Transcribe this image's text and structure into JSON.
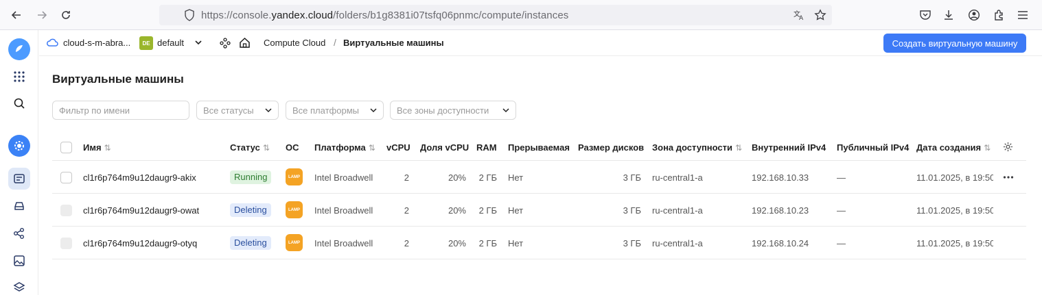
{
  "browser": {
    "url_prefix": "https://console.",
    "url_domain": "yandex.cloud",
    "url_path": "/folders/b1g8381i07tsfq06pnmc/compute/instances"
  },
  "header": {
    "cloud": "cloud-s-m-abra...",
    "folder_badge": "DE",
    "folder": "default",
    "breadcrumb_service": "Compute Cloud",
    "breadcrumb_sep": "/",
    "breadcrumb_page": "Виртуальные машины",
    "create_button": "Создать виртуальную машину"
  },
  "page": {
    "title": "Виртуальные машины"
  },
  "filters": {
    "name_placeholder": "Фильтр по имени",
    "status": "Все статусы",
    "platform": "Все платформы",
    "zone": "Все зоны доступности"
  },
  "table": {
    "columns": {
      "name": "Имя",
      "status": "Статус",
      "os": "ОС",
      "platform": "Платформа",
      "vcpu": "vCPU",
      "vcpu_share": "Доля vCPU",
      "ram": "RAM",
      "preemptible": "Прерываемая",
      "disk": "Размер дисков",
      "zone": "Зона доступности",
      "ipv4_int": "Внутренний IPv4",
      "ipv4_pub": "Публичный IPv4",
      "created": "Дата создания"
    },
    "os_label": "LAMP",
    "rows": [
      {
        "name": "cl1r6p764m9u12daugr9-akix",
        "status": "Running",
        "platform": "Intel Broadwell",
        "vcpu": "2",
        "vcpu_share": "20%",
        "ram": "2 ГБ",
        "preemptible": "Нет",
        "disk": "3 ГБ",
        "zone": "ru-central1-a",
        "ipv4_int": "192.168.10.33",
        "ipv4_pub": "—",
        "created": "11.01.2025, в 19:50"
      },
      {
        "name": "cl1r6p764m9u12daugr9-owat",
        "status": "Deleting",
        "platform": "Intel Broadwell",
        "vcpu": "2",
        "vcpu_share": "20%",
        "ram": "2 ГБ",
        "preemptible": "Нет",
        "disk": "3 ГБ",
        "zone": "ru-central1-a",
        "ipv4_int": "192.168.10.23",
        "ipv4_pub": "—",
        "created": "11.01.2025, в 19:50"
      },
      {
        "name": "cl1r6p764m9u12daugr9-otyq",
        "status": "Deleting",
        "platform": "Intel Broadwell",
        "vcpu": "2",
        "vcpu_share": "20%",
        "ram": "2 ГБ",
        "preemptible": "Нет",
        "disk": "3 ГБ",
        "zone": "ru-central1-a",
        "ipv4_int": "192.168.10.24",
        "ipv4_pub": "—",
        "created": "11.01.2025, в 19:50"
      }
    ]
  },
  "colors": {
    "accent": "#3d7af6",
    "running_bg": "#dff3e0",
    "deleting_bg": "#e3ebfb",
    "os_badge": "#f4a324"
  }
}
